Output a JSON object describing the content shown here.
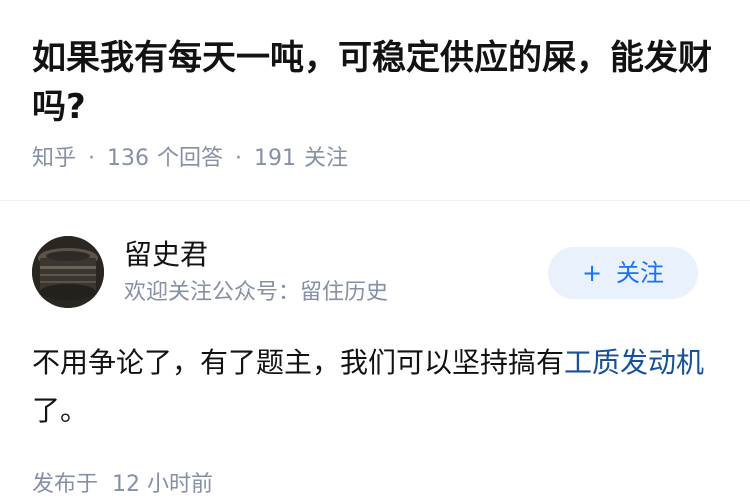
{
  "question": {
    "title": "如果我有每天一吨，可稳定供应的屎，能发财吗?",
    "site": "知乎",
    "separator": "·",
    "answer_count": "136",
    "answer_label": "个回答",
    "follower_count": "191",
    "follower_label": "关注"
  },
  "author": {
    "name": "留史君",
    "bio": "欢迎关注公众号：留住历史",
    "follow_plus": "+",
    "follow_label": "关注"
  },
  "answer": {
    "text_before": "不用争论了，有了题主，我们可以坚持搞有",
    "link_text": "工质发动机",
    "text_after": "了。",
    "time_prefix": "发布于",
    "time_value": "12 小时前"
  },
  "colors": {
    "link": "#175199",
    "meta_gray": "#8590a6",
    "follow_blue": "#1772f6",
    "follow_bg": "#e9f1fc"
  }
}
